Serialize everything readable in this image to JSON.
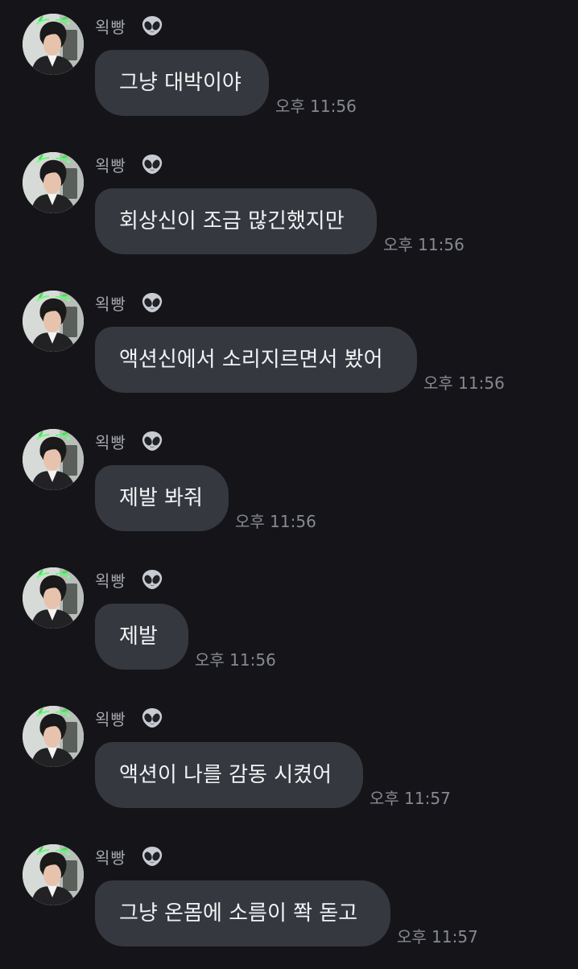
{
  "sender": {
    "name": "왹빵",
    "badge_icon": "alien-icon"
  },
  "messages": [
    {
      "text": "그냥 대박이야",
      "time": "오후 11:56"
    },
    {
      "text": "회상신이 조금 많긴했지만",
      "time": "오후 11:56"
    },
    {
      "text": "액션신에서 소리지르면서 봤어",
      "time": "오후 11:56"
    },
    {
      "text": "제발 봐줘",
      "time": "오후 11:56"
    },
    {
      "text": "제발",
      "time": "오후 11:56"
    },
    {
      "text": "액션이 나를 감동 시켰어",
      "time": "오후 11:57"
    },
    {
      "text": "그냥 온몸에 소름이 쫙 돋고",
      "time": "오후 11:57"
    }
  ],
  "colors": {
    "background": "#151519",
    "bubble": "#36383f",
    "message_text": "#f2f3f5",
    "meta_text": "#868991"
  }
}
